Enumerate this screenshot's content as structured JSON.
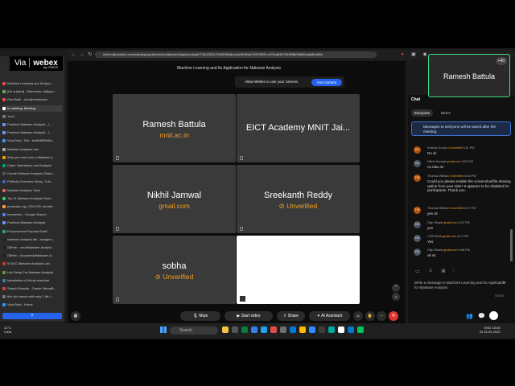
{
  "browser": {
    "url": "eictmnitjs.webex.com/webappng/sites/eictmnitjs/meeting/download/77bb1351b70945309abcacfc9b90da7937MRD=m70ba84b7094f58b38b62afab8be5f0c"
  },
  "tabs": [
    "Machine Learning and its Appl...",
    "[No subject] - 8deexuhu.rot@gm...",
    "Gerti Mail - eicc@mnitaucsn",
    "In meeting: Meeting",
    "YouC",
    "Practical Malware Analysis - L...",
    "Practical Malware Analysis - L...",
    "VirusTotal - File - ba89d0ff9e5a...",
    "Malware Analysis Lab",
    "Why you need you a Malware A...",
    "Cyber Operations and Analysis",
    "Create Malware Analysis Slides...",
    "Pelikulis Overview Setup, Tuto...",
    "Malware Analysis Tools",
    "Top 11 Malware Analysis Tools ...",
    "pmstudio.org | SSH-GS: bundle...",
    "Immersive - Google Search",
    "Practical Malware Analysis",
    "Procurement Proposal Draft",
    "malware analysis lab - assignm...",
    "GitHub - onur/Malware-Analysi...",
    "GitHub - Acrywinski/Malware-A...",
    "W 3CC Malware Analysis Lab",
    "Lab Setup For Malware Analysis",
    "Installation of Virtual machine",
    "Search Results - Oracle VirtualB...",
    "this lab comes with only 1 file l...",
    "VirusTotal - Home"
  ],
  "via_logo": {
    "via": "Via",
    "webex": "webex",
    "by": "by CISCO"
  },
  "meeting": {
    "title": "Machine Learning and Its Application for Malware Analysis",
    "camera_prompt": "Allow Webex to use your camera.",
    "camera_button": "Use camera",
    "tiles": [
      {
        "name": "Ramesh Battula",
        "sub": "mnit.ac.in",
        "sub_type": "org"
      },
      {
        "name": "EICT Academy MNIT Jai...",
        "sub": "",
        "sub_type": "none"
      },
      {
        "name": "Nikhil Jamwal",
        "sub": "gmail.com",
        "sub_type": "org"
      },
      {
        "name": "Sreekanth Reddy",
        "sub": "Unverified",
        "sub_type": "unverified"
      },
      {
        "name": "sobha",
        "sub": "Unverified",
        "sub_type": "unverified"
      },
      {
        "name": "",
        "sub": "",
        "sub_type": "blank"
      }
    ]
  },
  "controls": {
    "mute": "Mute",
    "start_video": "Start video",
    "share": "Share",
    "ai_assistant": "AI Assistant",
    "end": "✕"
  },
  "self_view": {
    "name": "Ramesh Battula",
    "count": "+40"
  },
  "chat": {
    "title": "Chat",
    "tab_everyone": "Everyone",
    "tab_direct": "Direct",
    "notice": "Messages to everyone will be saved after the meeting.",
    "messages": [
      {
        "initials": "KK",
        "color": "#b45309",
        "sender": "Krishan Kumar",
        "org": "",
        "verified": "Unverified",
        "time": "6:31 PM",
        "text": "No sir"
      },
      {
        "initials": "NJ",
        "color": "#4b5563",
        "sender": "Nikhil Jamwal",
        "org": "gmail.com",
        "verified": "",
        "time": "6:31 PM",
        "text": "no idea sir"
      },
      {
        "initials": "TW",
        "color": "#b45309",
        "sender": "Thomas William",
        "org": "",
        "verified": "Unverified",
        "time": "6:46 PM",
        "text": "Could you please enable the screenshot/file-sharing option from your side? It appears to be disabled for participants. Thank you."
      },
      {
        "initials": "TW",
        "color": "#b45309",
        "sender": "Thomas William",
        "org": "",
        "verified": "Unverified",
        "time": "6:47 PM",
        "text": "yes sir"
      },
      {
        "initials": "DS",
        "color": "#4b5563",
        "sender": "Dilip Shanti",
        "org": "gmail.com",
        "verified": "",
        "time": "6:47 PM",
        "text": "yes"
      },
      {
        "initials": "CH",
        "color": "#4b5563",
        "sender": "CHETANA",
        "org": "gmail.com",
        "verified": "",
        "time": "6:47 PM",
        "text": "Yes"
      },
      {
        "initials": "DS",
        "color": "#4b5563",
        "sender": "Dilip Shanti",
        "org": "gmail.com",
        "verified": "",
        "time": "6:58 PM",
        "text": "ok sir"
      }
    ],
    "compose_placeholder": "Write a message to Machine Learning and Its Application for Malware Analysis",
    "char_count": "0/5000"
  },
  "taskbar": {
    "weather_temp": "31°C",
    "weather_desc": "Clear",
    "search_placeholder": "Search",
    "lang": "ENG",
    "region": "IN",
    "time": "18:58",
    "date": "25-09-2025"
  }
}
